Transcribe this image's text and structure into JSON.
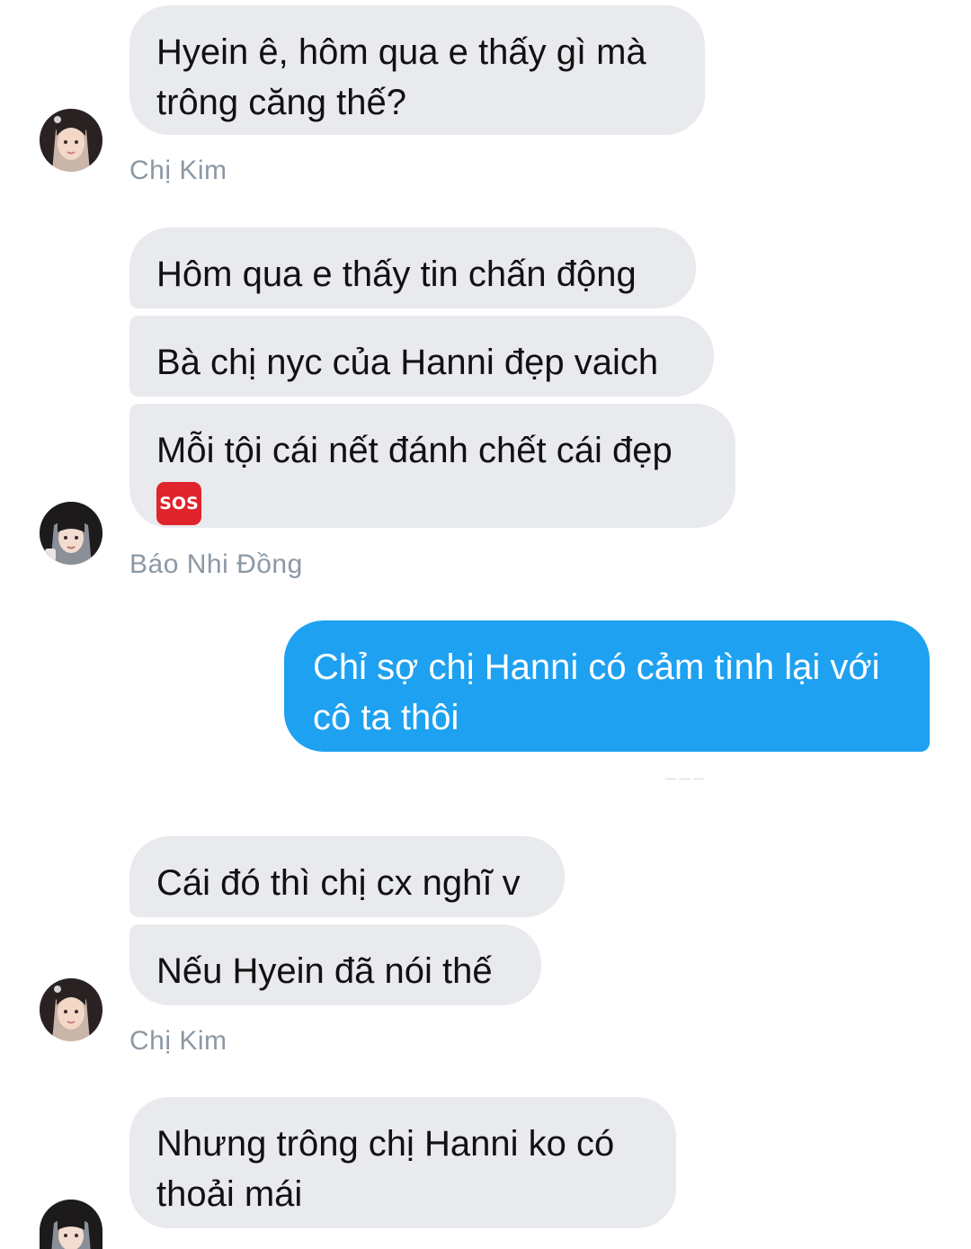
{
  "messages": [
    {
      "text": "Hyein ê, hôm qua e thấy gì mà trông căng thế?"
    },
    {
      "text": "Hôm qua e thấy tin chấn động"
    },
    {
      "text": "Bà chị nyc của Hanni đẹp vaich"
    },
    {
      "text": "Mỗi tội cái nết đánh chết cái đẹp",
      "emoji": "SOS"
    },
    {
      "text": "Chỉ sợ chị Hanni có cảm tình lại với cô ta thôi"
    },
    {
      "text": "Cái đó thì chị cx nghĩ v"
    },
    {
      "text": "Nếu Hyein đã nói thế"
    },
    {
      "text": "Nhưng trông chị Hanni ko có thoải mái"
    }
  ],
  "senders": [
    {
      "name": "Chị Kim",
      "avatar_icon": "avatar-chi-kim"
    },
    {
      "name": "Báo Nhi Đồng",
      "avatar_icon": "avatar-bao-nhi-dong"
    },
    {
      "name": "Chị Kim",
      "avatar_icon": "avatar-chi-kim"
    },
    {
      "avatar_icon": "avatar-bao-nhi-dong"
    }
  ],
  "colors": {
    "incoming_bubble": "#e8eaee",
    "outgoing_bubble": "#1ea1f1",
    "sender_name": "#8b98a5"
  }
}
